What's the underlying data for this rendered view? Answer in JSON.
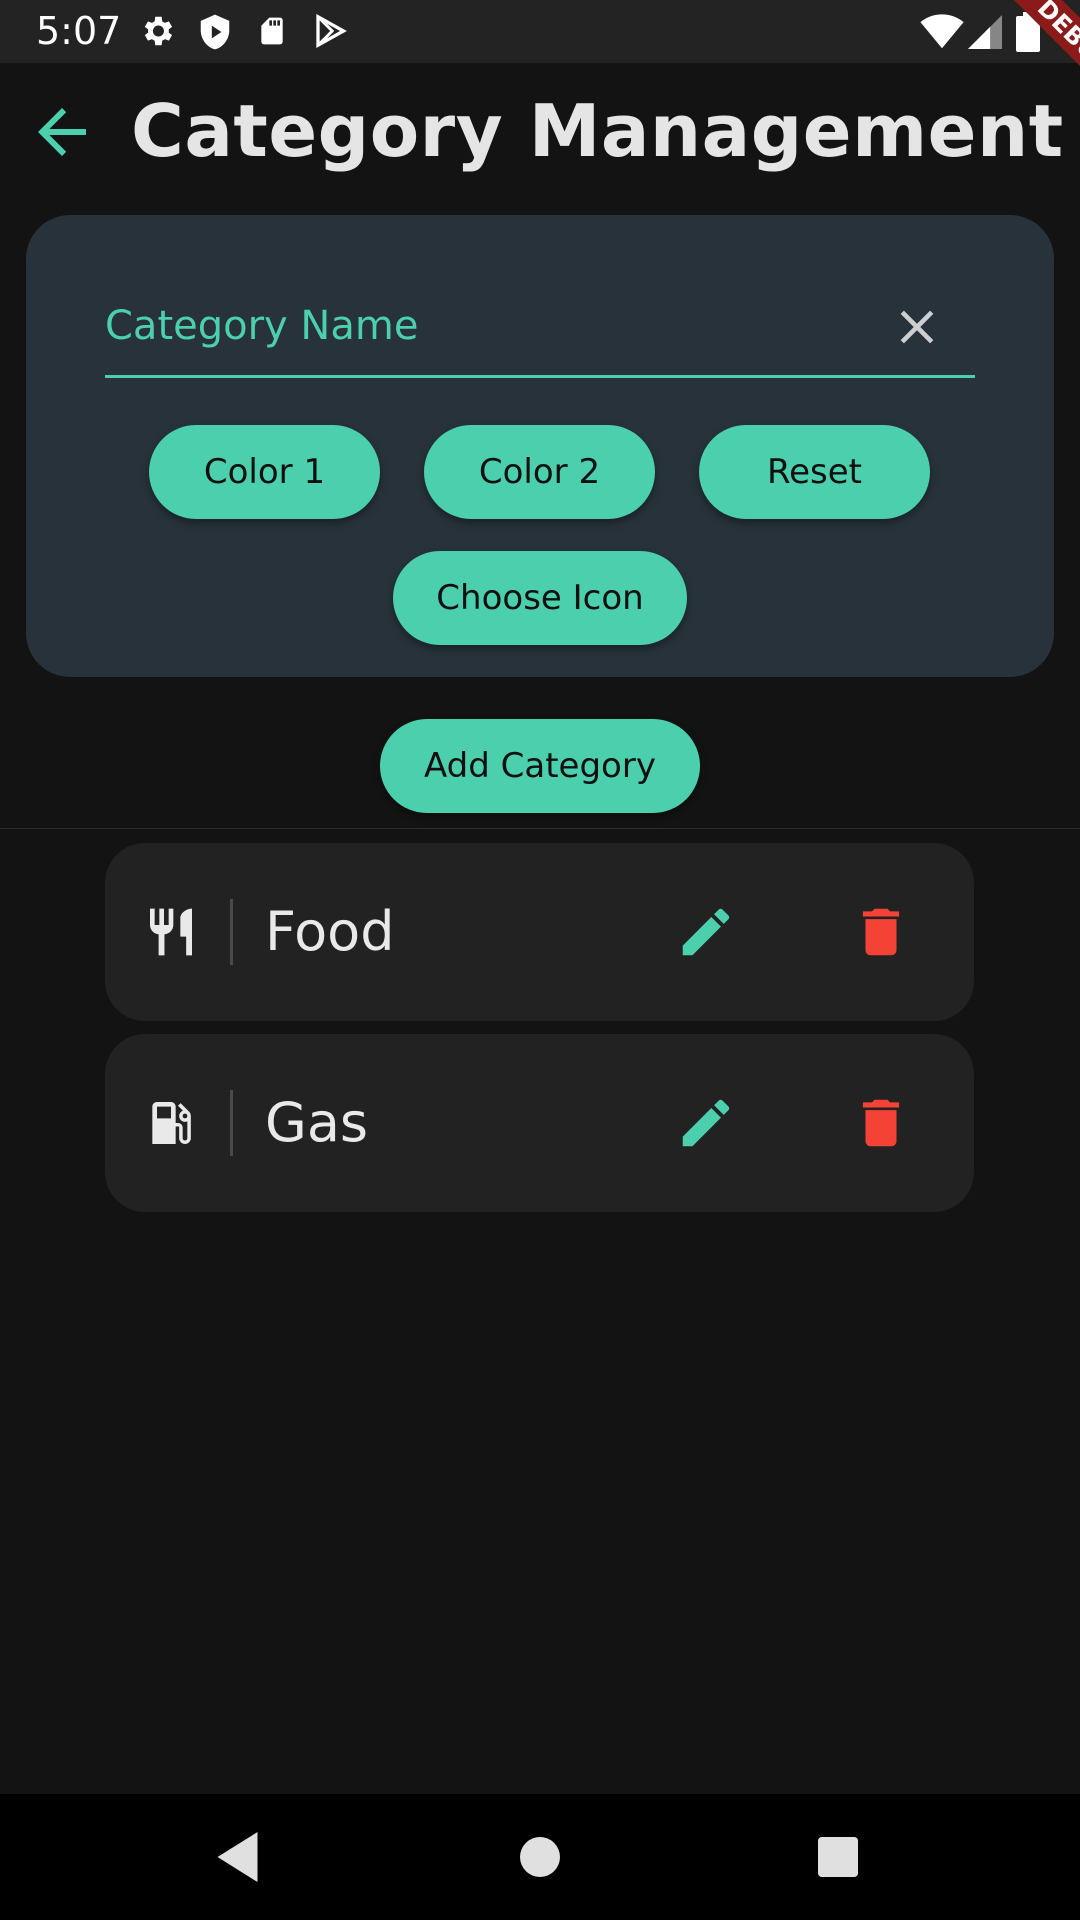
{
  "status_bar": {
    "time": "5:07",
    "left_icons": [
      "settings-icon",
      "shield-icon",
      "sd-card-icon",
      "play-store-icon"
    ],
    "right_icons": [
      "wifi-icon",
      "signal-icon",
      "battery-icon"
    ]
  },
  "debug_banner": {
    "label": "DEBUG"
  },
  "app_bar": {
    "title": "Category Management",
    "back_icon": "arrow-back-icon"
  },
  "form": {
    "name_placeholder": "Category Name",
    "clear_icon": "close-icon",
    "color1_label": "Color 1",
    "color2_label": "Color 2",
    "reset_label": "Reset",
    "choose_icon_label": "Choose Icon"
  },
  "add_category_label": "Add Category",
  "categories": [
    {
      "name": "Food",
      "icon": "restaurant-icon"
    },
    {
      "name": "Gas",
      "icon": "gas-station-icon"
    }
  ],
  "colors": {
    "accent": "#4bcfac",
    "danger": "#f44336",
    "card": "#27323a",
    "row": "#222222",
    "background": "#131313"
  },
  "nav_bar": {
    "buttons": [
      "back-triangle-icon",
      "home-circle-icon",
      "recents-square-icon"
    ]
  }
}
